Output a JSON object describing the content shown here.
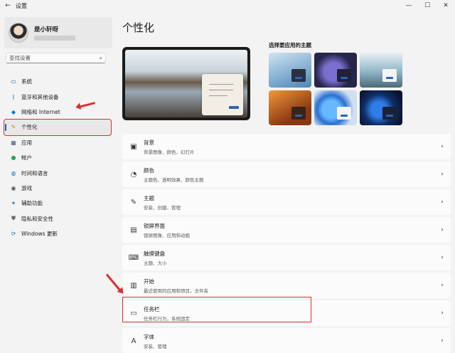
{
  "window": {
    "title": "设置",
    "back_icon": "back-arrow-icon",
    "controls": [
      "minimize",
      "maximize",
      "close"
    ]
  },
  "profile": {
    "name": "是小轩呀"
  },
  "search": {
    "placeholder": "查找设置"
  },
  "sidebar": {
    "items": [
      {
        "label": "系统",
        "icon": "system-icon",
        "icon_color": "#0067c0"
      },
      {
        "label": "蓝牙和其他设备",
        "icon": "bluetooth-icon",
        "icon_color": "#0067c0"
      },
      {
        "label": "网络和 Internet",
        "icon": "wifi-icon",
        "icon_color": "#0078d4"
      },
      {
        "label": "个性化",
        "icon": "brush-icon",
        "icon_color": "#d08a2b",
        "active": true
      },
      {
        "label": "应用",
        "icon": "apps-icon",
        "icon_color": "#4a5a78"
      },
      {
        "label": "帐户",
        "icon": "account-icon",
        "icon_color": "#2ea24a"
      },
      {
        "label": "时间和语言",
        "icon": "globe-icon",
        "icon_color": "#1a73b8"
      },
      {
        "label": "游戏",
        "icon": "gamepad-icon",
        "icon_color": "#555555"
      },
      {
        "label": "辅助功能",
        "icon": "accessibility-icon",
        "icon_color": "#1a73b8"
      },
      {
        "label": "隐私和安全性",
        "icon": "shield-icon",
        "icon_color": "#6b6b6b"
      },
      {
        "label": "Windows 更新",
        "icon": "windows-update-icon",
        "icon_color": "#0078d4"
      }
    ]
  },
  "main": {
    "title": "个性化",
    "themes_label": "选择要应用的主题",
    "themes": [
      {
        "name": "theme-1",
        "bg": "#6fa3c7"
      },
      {
        "name": "theme-2",
        "bg": "#3c3e6a"
      },
      {
        "name": "theme-3",
        "bg": "#8fb5c8"
      },
      {
        "name": "theme-4",
        "bg": "#b0561f"
      },
      {
        "name": "theme-5",
        "bg": "#3a8fd8"
      },
      {
        "name": "theme-6",
        "bg": "#10214a"
      }
    ],
    "rows": [
      {
        "title": "背景",
        "sub": "背景图像、颜色、幻灯片",
        "icon": "picture-icon"
      },
      {
        "title": "颜色",
        "sub": "主题色、透明效果、颜色主题",
        "icon": "palette-icon"
      },
      {
        "title": "主题",
        "sub": "安装、创建、管理",
        "icon": "pen-icon"
      },
      {
        "title": "锁屏界面",
        "sub": "锁屏图像、应用和动画",
        "icon": "lock-screen-icon"
      },
      {
        "title": "触摸键盘",
        "sub": "主题、大小",
        "icon": "keyboard-icon"
      },
      {
        "title": "开始",
        "sub": "最近使用的应用和项目，文件夹",
        "icon": "start-icon"
      },
      {
        "title": "任务栏",
        "sub": "任务栏行为，系统固定",
        "icon": "taskbar-icon"
      },
      {
        "title": "字体",
        "sub": "安装、管理",
        "icon": "font-icon"
      }
    ]
  },
  "colors": {
    "accent": "#0067c0",
    "annotation": "#d93030"
  }
}
